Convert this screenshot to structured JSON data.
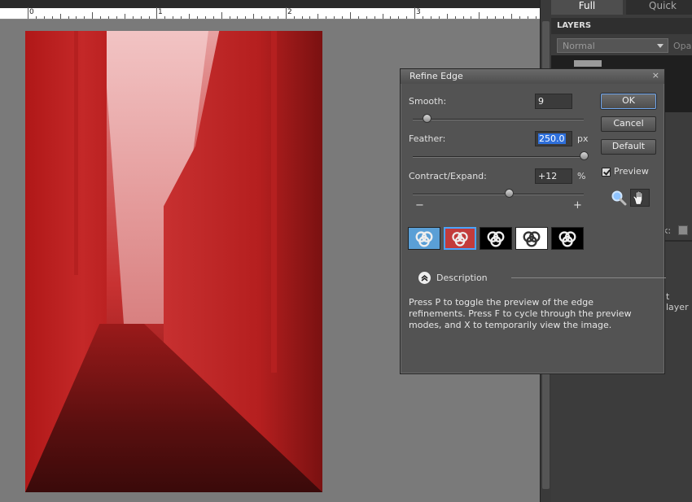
{
  "ruler": {
    "marks": [
      "0",
      "1",
      "2",
      "3"
    ]
  },
  "panel": {
    "tabs": [
      {
        "label": "Full"
      },
      {
        "label": "Quick"
      }
    ],
    "layers_title": "LAYERS",
    "blend_mode": "Normal",
    "opacity_label": "Opa",
    "lock_fragment": "k:",
    "layer_fragment": "t layer"
  },
  "dialog": {
    "title": "Refine Edge",
    "close": "×",
    "smooth": {
      "label": "Smooth:",
      "value": "9",
      "level": 0.08
    },
    "feather": {
      "label": "Feather:",
      "value": "250.0",
      "unit": "px",
      "level": 1.0
    },
    "contract": {
      "label": "Contract/Expand:",
      "value": "+12",
      "unit": "%",
      "level": 0.56,
      "minus": "−",
      "plus": "+"
    },
    "buttons": {
      "ok": "OK",
      "cancel": "Cancel",
      "default": "Default"
    },
    "preview_label": "Preview",
    "preview_checked": true,
    "preview_modes": [
      {
        "name": "custom-overlay",
        "bg": "#5a9fd6",
        "active": false
      },
      {
        "name": "quick-mask",
        "bg": "#c23b3b",
        "active": true
      },
      {
        "name": "on-black",
        "bg": "#000000",
        "active": false
      },
      {
        "name": "on-white",
        "bg": "#ffffff",
        "active": false
      },
      {
        "name": "mask",
        "bg": "#000000",
        "active": false
      }
    ],
    "description_label": "Description",
    "description_text": "Press P to toggle the preview of the edge refinements. Press F to cycle through the preview modes, and X to temporarily view the image."
  }
}
